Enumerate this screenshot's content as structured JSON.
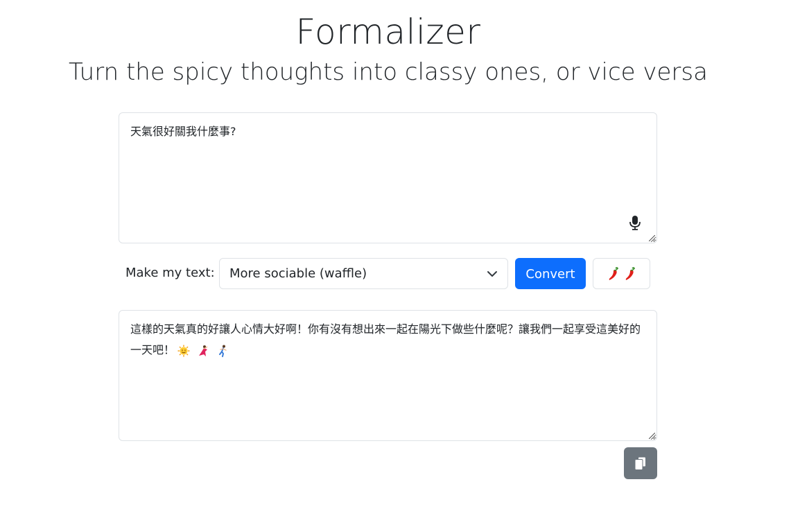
{
  "header": {
    "title": "Formalizer",
    "subtitle": "Turn the spicy thoughts into classy ones, or vice versa"
  },
  "input": {
    "value": "天氣很好關我什麼事?"
  },
  "controls": {
    "label": "Make my text:",
    "selected_option": "More sociable (waffle)",
    "convert_label": "Convert"
  },
  "output": {
    "text": "這樣的天氣真的好讓人心情大好啊！你有沒有想出來一起在陽光下做些什麼呢？讓我們一起享受這美好的一天吧！",
    "emojis": [
      "sun-face-icon",
      "dancer-icon",
      "running-person-icon"
    ]
  },
  "colors": {
    "primary": "#0d6efd",
    "secondary": "#6c757d",
    "border": "#dee2e6",
    "text": "#212529"
  },
  "icons": {
    "mic": "microphone-icon",
    "chevron": "chevron-down-icon",
    "pepper": "chili-pepper-icon",
    "copy": "copy-icon"
  }
}
